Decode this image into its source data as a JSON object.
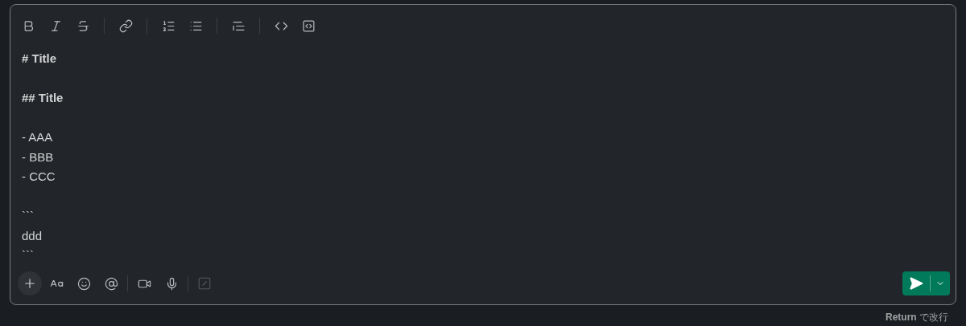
{
  "editor": {
    "lines": [
      {
        "kind": "bold",
        "text": "# Title"
      },
      {
        "kind": "blank"
      },
      {
        "kind": "bold",
        "text": "## Title"
      },
      {
        "kind": "blank"
      },
      {
        "kind": "text",
        "text": "- AAA"
      },
      {
        "kind": "text",
        "text": "- BBB"
      },
      {
        "kind": "text",
        "text": "- CCC"
      },
      {
        "kind": "blank"
      },
      {
        "kind": "text",
        "text": "```"
      },
      {
        "kind": "text",
        "text": "ddd"
      },
      {
        "kind": "text",
        "text": "```"
      }
    ]
  },
  "hint": "**Return** で改行"
}
